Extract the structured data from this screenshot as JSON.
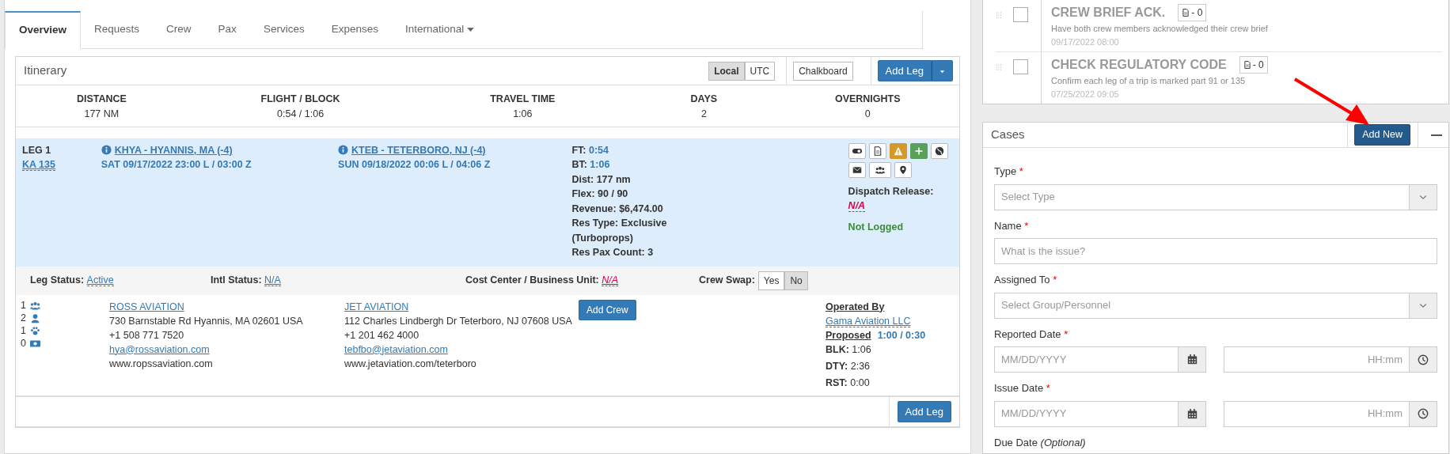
{
  "tabs": [
    {
      "label": "Overview",
      "selected": true,
      "dropdown": false
    },
    {
      "label": "Requests",
      "selected": false,
      "dropdown": false
    },
    {
      "label": "Crew",
      "selected": false,
      "dropdown": false
    },
    {
      "label": "Pax",
      "selected": false,
      "dropdown": false
    },
    {
      "label": "Services",
      "selected": false,
      "dropdown": false
    },
    {
      "label": "Expenses",
      "selected": false,
      "dropdown": false
    },
    {
      "label": "International",
      "selected": false,
      "dropdown": true
    }
  ],
  "itinerary": {
    "title": "Itinerary",
    "time_modes": [
      {
        "label": "Local",
        "selected": true
      },
      {
        "label": "UTC",
        "selected": false
      }
    ],
    "chalkboard_button": "Chalkboard",
    "add_leg_button": "Add Leg",
    "summary": [
      {
        "label": "DISTANCE",
        "value": "177 NM"
      },
      {
        "label": "FLIGHT / BLOCK",
        "value": "0:54 / 1:06"
      },
      {
        "label": "TRAVEL TIME",
        "value": "1:06"
      },
      {
        "label": "DAYS",
        "value": "2"
      },
      {
        "label": "OVERNIGHTS",
        "value": "0"
      }
    ],
    "leg": {
      "title": "LEG 1",
      "flight": "KA 135",
      "departure": {
        "airport": "KHYA - HYANNIS, MA (-4)",
        "time": "SAT 09/17/2022 23:00 L / 03:00 Z"
      },
      "arrival": {
        "airport": "KTEB - TETERBORO, NJ (-4)",
        "time": "SUN 09/18/2022 00:06 L / 04:06 Z"
      },
      "stats": [
        {
          "label": "FT:",
          "value": "0:54",
          "kind": "link"
        },
        {
          "label": "BT:",
          "value": "1:06",
          "kind": "link"
        },
        {
          "label": "Dist:",
          "value": "177 nm",
          "kind": "plain"
        },
        {
          "label": "Flex:",
          "value": "90 / 90",
          "kind": "plain"
        },
        {
          "label": "Revenue:",
          "value": "$6,474.00",
          "kind": "plain"
        },
        {
          "label": "Res Type:",
          "value": "Exclusive (Turboprops)",
          "kind": "plain"
        },
        {
          "label": "Res Pax Count:",
          "value": "3",
          "kind": "plain"
        }
      ],
      "dispatch_release": {
        "label": "Dispatch Release:",
        "value": "N/A"
      },
      "log_status": "Not Logged"
    },
    "status_bar": [
      {
        "label": "Leg Status:",
        "value": "Active",
        "kind": "link"
      },
      {
        "label": "Intl Status:",
        "value": "N/A",
        "kind": "link"
      },
      {
        "label": "Cost Center / Business Unit:",
        "value": "N/A",
        "kind": "missing"
      }
    ],
    "crew_swap": {
      "label": "Crew Swap:",
      "options": [
        {
          "label": "Yes",
          "selected": false
        },
        {
          "label": "No",
          "selected": true
        }
      ]
    },
    "counts": [
      {
        "count": "1",
        "kind": "crew"
      },
      {
        "count": "2",
        "kind": "pax"
      },
      {
        "count": "1",
        "kind": "pets"
      },
      {
        "count": "0",
        "kind": "cash"
      }
    ],
    "fbos": [
      {
        "name": "ROSS AVIATION",
        "address": "730 Barnstable Rd Hyannis, MA 02601 USA",
        "phone": "+1 508 771 7520",
        "email": "hya@rossaviation.com",
        "website": "www.ropssaviation.com"
      },
      {
        "name": "JET AVIATION",
        "address": "112 Charles Lindbergh Dr Teterboro, NJ 07608 USA",
        "phone": "+1 201 462 4000",
        "email": "tebfbo@jetaviation.com",
        "website": "www.jetaviation.com/teterboro"
      }
    ],
    "add_crew_button": "Add Crew",
    "operated_by": {
      "label": "Operated By",
      "operator": "Gama Aviation LLC",
      "proposed_label": "Proposed",
      "proposed_value": "1:00 / 0:30",
      "limits": [
        {
          "label": "BLK:",
          "value": "1:06"
        },
        {
          "label": "DTY:",
          "value": "2:36"
        },
        {
          "label": "RST:",
          "value": "0:00"
        }
      ]
    },
    "footer_button": "Add Leg"
  },
  "checklist": [
    {
      "title": "CREW BRIEF ACK.",
      "docs": "- 0",
      "description": "Have both crew members acknowledged their crew brief",
      "date": "09/17/2022 08:00",
      "checked": false
    },
    {
      "title": "CHECK REGULATORY CODE",
      "docs": "- 0",
      "description": "Confirm each leg of a trip is marked part 91 or 135",
      "date": "07/25/2022 09:05",
      "checked": false
    }
  ],
  "cases": {
    "title": "Cases",
    "add_button": "Add New",
    "fields": [
      {
        "label": "Type",
        "required_mark": "*",
        "kind": "select",
        "placeholder": "Select Type"
      },
      {
        "label": "Name",
        "required_mark": "*",
        "kind": "text",
        "placeholder": "What is the issue?"
      },
      {
        "label": "Assigned To",
        "required_mark": "*",
        "kind": "select",
        "placeholder": "Select Group/Personnel"
      },
      {
        "label": "Reported Date",
        "required_mark": "*",
        "kind": "datetime",
        "placeholder": "MM/DD/YYYY",
        "time_placeholder": "HH:mm"
      },
      {
        "label": "Issue Date",
        "required_mark": "*",
        "kind": "datetime",
        "placeholder": "MM/DD/YYYY",
        "time_placeholder": "HH:mm"
      },
      {
        "label": "Due Date",
        "note": "(Optional)",
        "kind": "heading"
      }
    ]
  }
}
